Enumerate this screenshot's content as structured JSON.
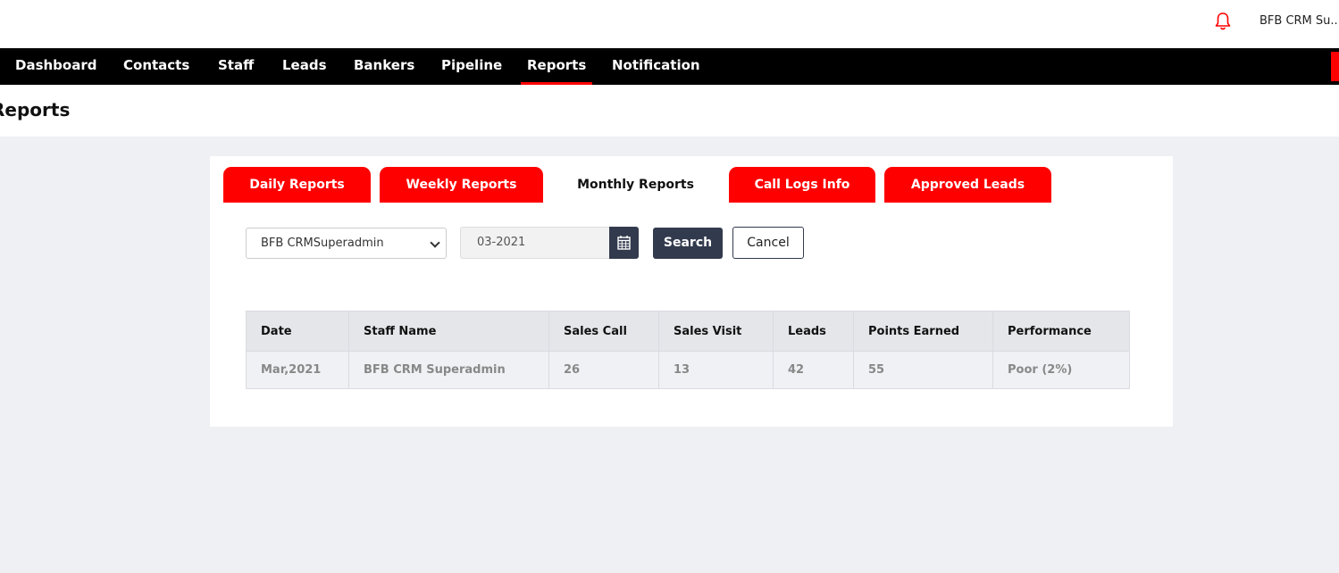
{
  "header": {
    "user_name": "BFB CRM Su...",
    "bell_icon": "bell-icon"
  },
  "nav": {
    "items": [
      {
        "label": "Dashboard"
      },
      {
        "label": "Contacts"
      },
      {
        "label": "Staff"
      },
      {
        "label": "Leads"
      },
      {
        "label": "Bankers"
      },
      {
        "label": "Pipeline"
      },
      {
        "label": "Reports",
        "active": true
      },
      {
        "label": "Notification"
      }
    ]
  },
  "page": {
    "title": "Reports"
  },
  "tabs": [
    {
      "label": "Daily Reports"
    },
    {
      "label": "Weekly Reports"
    },
    {
      "label": "Monthly Reports",
      "active": true
    },
    {
      "label": "Call Logs Info"
    },
    {
      "label": "Approved Leads"
    }
  ],
  "filters": {
    "staff_select_value": "BFB CRMSuperadmin",
    "date_value": "03-2021",
    "search_label": "Search",
    "cancel_label": "Cancel",
    "calendar_icon": "calendar-icon"
  },
  "table": {
    "headers": [
      "Date",
      "Staff Name",
      "Sales Call",
      "Sales Visit",
      "Leads",
      "Points Earned",
      "Performance"
    ],
    "rows": [
      [
        "Mar,2021",
        "BFB CRM Superadmin",
        "26",
        "13",
        "42",
        "55",
        "Poor (2%)"
      ]
    ]
  },
  "colors": {
    "accent_red": "#ff0000",
    "nav_bg": "#000000",
    "button_dark": "#323a4d",
    "page_bg": "#eff0f4"
  }
}
